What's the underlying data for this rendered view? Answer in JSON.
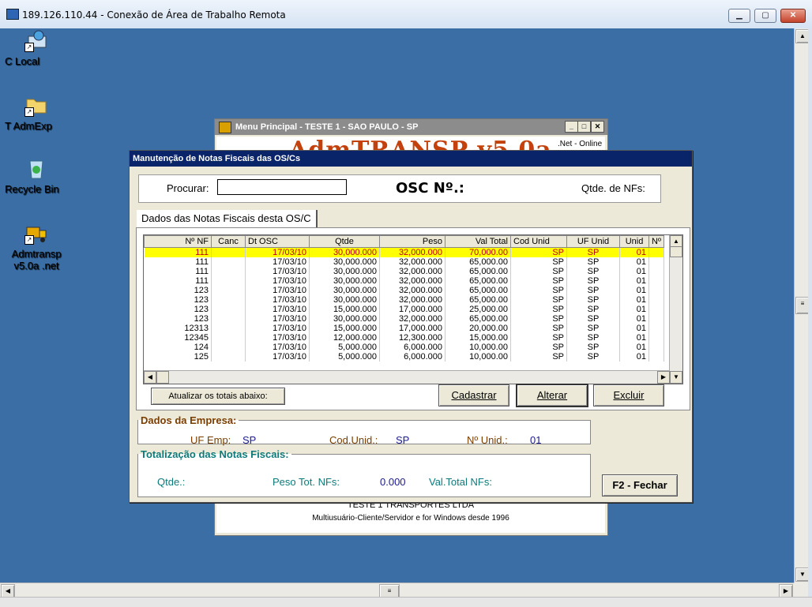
{
  "rdp": {
    "title": "189.126.110.44 - Conexão de Área de Trabalho Remota",
    "minimize": "▁",
    "maximize": "▢",
    "close": "✕"
  },
  "desktop_icons": [
    {
      "label": "C Local"
    },
    {
      "label": "T AdmExp"
    },
    {
      "label": "Recycle Bin"
    },
    {
      "label": "Admtransp v5.0a .net"
    }
  ],
  "bg_window": {
    "title": "Menu Principal - TESTE 1 - SAO PAULO - SP",
    "logo": "AdmTRANSP v5.0a",
    "net": ".Net - Online",
    "company": "TESTE 1 TRANSPORTES LTDA",
    "tagline": "Multiusuário-Cliente/Servidor e for Windows desde 1996"
  },
  "dialog": {
    "title": "Manutenção de Notas Fiscais das OS/Cs",
    "search_label": "Procurar:",
    "search_value": "",
    "osc_label": "OSC  Nº.:",
    "qtde_nfs_label": "Qtde. de NFs:",
    "tab_label": "Dados das Notas Fiscais desta OS/C",
    "columns": [
      "Nº NF",
      "Canc",
      "Dt OSC",
      "Qtde",
      "Peso",
      "Val Total",
      "Cod Unid",
      "UF Unid",
      "Unid",
      "Nº"
    ],
    "rows": [
      [
        "111",
        "",
        "17/03/10",
        "30,000.000",
        "32,000.000",
        "70,000.00",
        "SP",
        "SP",
        "01"
      ],
      [
        "111",
        "",
        "17/03/10",
        "30,000.000",
        "32,000.000",
        "65,000.00",
        "SP",
        "SP",
        "01"
      ],
      [
        "111",
        "",
        "17/03/10",
        "30,000.000",
        "32,000.000",
        "65,000.00",
        "SP",
        "SP",
        "01"
      ],
      [
        "111",
        "",
        "17/03/10",
        "30,000.000",
        "32,000.000",
        "65,000.00",
        "SP",
        "SP",
        "01"
      ],
      [
        "123",
        "",
        "17/03/10",
        "30,000.000",
        "32,000.000",
        "65,000.00",
        "SP",
        "SP",
        "01"
      ],
      [
        "123",
        "",
        "17/03/10",
        "30,000.000",
        "32,000.000",
        "65,000.00",
        "SP",
        "SP",
        "01"
      ],
      [
        "123",
        "",
        "17/03/10",
        "15,000.000",
        "17,000.000",
        "25,000.00",
        "SP",
        "SP",
        "01"
      ],
      [
        "123",
        "",
        "17/03/10",
        "30,000.000",
        "32,000.000",
        "65,000.00",
        "SP",
        "SP",
        "01"
      ],
      [
        "12313",
        "",
        "17/03/10",
        "15,000.000",
        "17,000.000",
        "20,000.00",
        "SP",
        "SP",
        "01"
      ],
      [
        "12345",
        "",
        "17/03/10",
        "12,000.000",
        "12,300.000",
        "15,000.00",
        "SP",
        "SP",
        "01"
      ],
      [
        "124",
        "",
        "17/03/10",
        "5,000.000",
        "6,000.000",
        "10,000.00",
        "SP",
        "SP",
        "01"
      ],
      [
        "125",
        "",
        "17/03/10",
        "5,000.000",
        "6,000.000",
        "10,000.00",
        "SP",
        "SP",
        "01"
      ]
    ],
    "btn_atualizar": "Atualizar os totais abaixo:",
    "btn_cadastrar": "Cadastrar",
    "btn_alterar": "Alterar",
    "btn_excluir": "Excluir",
    "empresa": {
      "legend": "Dados da Empresa:",
      "uf_label": "UF Emp:",
      "uf_value": "SP",
      "cod_label": "Cod.Unid.:",
      "cod_value": "SP",
      "num_label": "Nº Unid.:",
      "num_value": "01"
    },
    "totais": {
      "legend": "Totalização das Notas Fiscais:",
      "qtde_label": "Qtde.:",
      "peso_label": "Peso Tot. NFs:",
      "peso_value": "0.000",
      "val_label": "Val.Total NFs:"
    },
    "btn_fechar": "F2 - Fechar"
  },
  "colors": {
    "desktop": "#3a6ea5",
    "dialog_title": "#0a246a",
    "selected_row": "#ffff00",
    "selected_text": "#c00000",
    "empresa_legend": "#7a3e00",
    "totais_legend": "#0e7a7a",
    "value_blue": "#1a1a8c"
  }
}
